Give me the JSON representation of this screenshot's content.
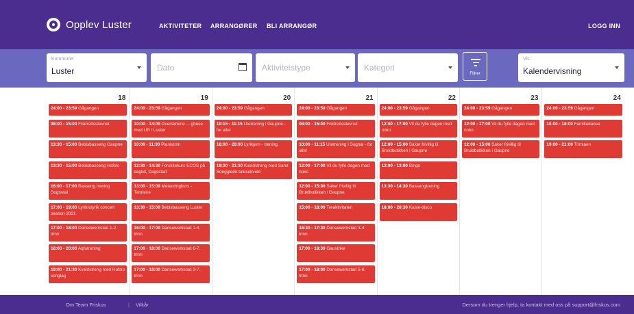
{
  "header": {
    "brand": "Opplev Luster",
    "nav": [
      "AKTIVITETER",
      "ARRANGØRER",
      "BLI ARRANGØR"
    ],
    "login": "LOGG INN"
  },
  "filters": {
    "kommune_label": "Kommune",
    "kommune_value": "Luster",
    "dato_placeholder": "Dato",
    "aktivitet_placeholder": "Aktivitetstype",
    "kategori_placeholder": "Kategori",
    "filter_button": "Filtrer",
    "vis_label": "Vis",
    "vis_value": "Kalendervisning"
  },
  "calendar": {
    "days": [
      {
        "day": "18",
        "events": [
          {
            "time": "24:00 - 23:59",
            "title": "Gågangen"
          },
          {
            "time": "08:00 - 15:00",
            "title": "Friidrettsstevnet"
          },
          {
            "time": "13:30 - 15:00",
            "title": "Bebisbasseng Gaupne"
          },
          {
            "time": "13:30 - 15:00",
            "title": "Bebisbasseng Hafslo"
          },
          {
            "time": "16:00 - 17:00",
            "title": "Basseng trening Sognstal"
          },
          {
            "time": "17:00 - 19:00",
            "title": "Lyrikrolyrik concert season 2021"
          },
          {
            "time": "17:00 - 18:00",
            "title": "Dansewerkstad 1-2. trinn"
          },
          {
            "time": "18:00 - 20:00",
            "title": "Aqfutrening"
          },
          {
            "time": "19:00 - 21:30",
            "title": "Kveldstreng med Hafslo songlag"
          }
        ]
      },
      {
        "day": "19",
        "events": [
          {
            "time": "24:00 - 23:59",
            "title": "Gågangen"
          },
          {
            "time": "10:00 - 14:00",
            "title": "Overskrivne ... ghuse med UR i Luster"
          },
          {
            "time": "10:00 - 11:30",
            "title": "Pianistrim"
          },
          {
            "time": "12:30 - 14:30",
            "title": "Forskitekurs ECOS på dagtid, Dagsstart"
          },
          {
            "time": "13:00 - 15:00",
            "title": "Meteoringkurs - Tennene"
          },
          {
            "time": "13:30 - 15:00",
            "title": "Bebisbasseng Luster"
          },
          {
            "time": "16:00 - 17:00",
            "title": "Dansewerkstad 1-4. trinn"
          },
          {
            "time": "17:00 - 18:00",
            "title": "Dansewerkstad 6-7. trinn"
          },
          {
            "time": "17:00 - 18:00",
            "title": "Dansewerkstad 3-7. trinn"
          }
        ]
      },
      {
        "day": "20",
        "events": [
          {
            "time": "24:00 - 23:59",
            "title": "Gågangen"
          },
          {
            "time": "10:15 - 11:15",
            "title": "Utetrening i Gaupne - for alle!"
          },
          {
            "time": "18:00 - 20:00",
            "title": "Lyrikjern - trening"
          },
          {
            "time": "19:30 - 21:30",
            "title": "Kveldstreng med Sand Songglede tolesekveld"
          }
        ]
      },
      {
        "day": "21",
        "events": [
          {
            "time": "24:00 - 23:59",
            "title": "Gågangen"
          },
          {
            "time": "08:00 - 15:00",
            "title": "Friidrettsstevnet"
          },
          {
            "time": "10:00 - 11:15",
            "title": "Utetrening i Sognal - for alle!"
          },
          {
            "time": "12:00 - 17:00",
            "title": "Vil du fylle dagen med noko"
          },
          {
            "time": "12:00 - 15:00",
            "title": "Saker frivillig til Bruktbutikken i Gaupne"
          },
          {
            "time": "15:00 - 18:00",
            "title": "Treaktivitaten"
          },
          {
            "time": "16:30 - 17:30",
            "title": "Dansewerkstad 3-4. trinn"
          },
          {
            "time": "17:00 - 18:30",
            "title": "Gaustrike"
          },
          {
            "time": "17:00 - 18:00",
            "title": "Dansewerkstad 5-6. trinn"
          }
        ]
      },
      {
        "day": "22",
        "events": [
          {
            "time": "24:00 - 23:59",
            "title": "Gågangen"
          },
          {
            "time": "12:00 - 17:00",
            "title": "Vil du fylle dagen med noko"
          },
          {
            "time": "12:00 - 15:00",
            "title": "Saker frivillig til Bruktbutikken i Gaupne"
          },
          {
            "time": "13:00 - 13:00",
            "title": "Bingo"
          },
          {
            "time": "13:30 - 14:30",
            "title": "Bassengtrening"
          },
          {
            "time": "18:00 - 20:30",
            "title": "Kaste-disco"
          }
        ]
      },
      {
        "day": "23",
        "events": [
          {
            "time": "24:00 - 23:59",
            "title": "Gågangen"
          },
          {
            "time": "12:00 - 17:00",
            "title": "Vil du fylle dagen med noko"
          },
          {
            "time": "12:00 - 15:00",
            "title": "Saker frivillig til Bruktbutikken i Gaupne"
          }
        ]
      },
      {
        "day": "24",
        "events": [
          {
            "time": "24:00 - 23:59",
            "title": "Gågangen"
          },
          {
            "time": "16:00 - 18:00",
            "title": "Familiedanse"
          },
          {
            "time": "19:00 - 21:00",
            "title": "Trimlaen"
          }
        ]
      }
    ]
  },
  "footer": {
    "team": "Om Team Friskus",
    "separator": "|",
    "terms": "Vilkår",
    "help": "Dersom du trenger hjelp, ta kontakt med oss på support@friskus.com"
  },
  "colors": {
    "nav_bg": "#4a2d8e",
    "filter_bg": "#6a68bf",
    "event_bg": "#e03a35"
  }
}
